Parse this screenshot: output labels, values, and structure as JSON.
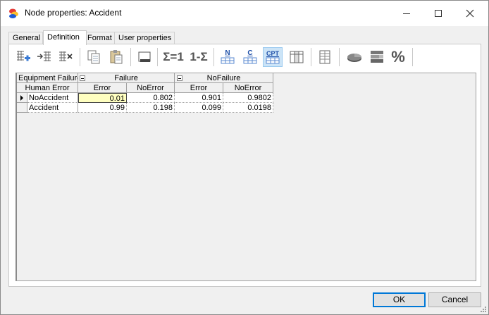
{
  "window": {
    "title": "Node properties: Accident",
    "controls": {
      "minimize": "minimize",
      "maximize": "maximize",
      "close": "close"
    }
  },
  "tabs": [
    {
      "label": "General",
      "active": false
    },
    {
      "label": "Definition",
      "active": true
    },
    {
      "label": "Format",
      "active": false
    },
    {
      "label": "User properties",
      "active": false
    }
  ],
  "toolbar": {
    "normalize_label": "Σ=1",
    "complement_label": "1-Σ",
    "n_label": "N",
    "c_label": "C",
    "cpt_label": "CPT",
    "percent_label": "%",
    "icons": [
      "add-row-icon",
      "insert-row-icon",
      "delete-row-icon",
      "copy-icon",
      "paste-icon",
      "edit-icon",
      "normalize-icon",
      "complement-icon",
      "noisy-n-icon",
      "noisy-c-icon",
      "cpt-icon",
      "columns-icon",
      "table-icon",
      "pie-chart-icon",
      "stack-chart-icon",
      "percent-icon"
    ]
  },
  "table": {
    "parent1": {
      "name": "Equipment Failure",
      "states": [
        {
          "label": "Failure",
          "children": [
            "Error",
            "NoError"
          ]
        },
        {
          "label": "NoFailure",
          "children": [
            "Error",
            "NoError"
          ]
        }
      ]
    },
    "parent2_name": "Human Error",
    "rows": [
      {
        "label": "NoAccident",
        "values": [
          "0.01",
          "0.802",
          "0.901",
          "0.9802"
        ]
      },
      {
        "label": "Accident",
        "values": [
          "0.99",
          "0.198",
          "0.099",
          "0.0198"
        ]
      }
    ]
  },
  "buttons": {
    "ok": "OK",
    "cancel": "Cancel"
  },
  "colors": {
    "selected_cell": "#ffffc0",
    "default_button_border": "#0078d7"
  }
}
